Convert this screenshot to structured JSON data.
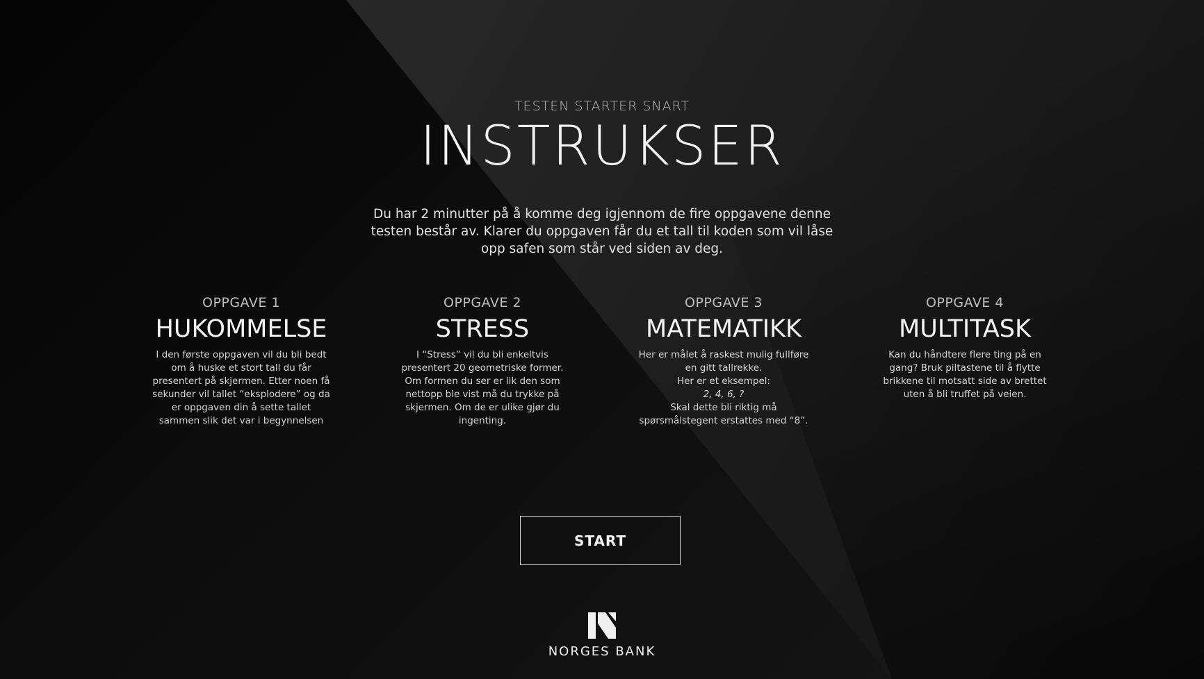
{
  "header": {
    "kicker": "TESTEN STARTER SNART",
    "title": "INSTRUKSER"
  },
  "intro": {
    "text": "Du har 2 minutter på å komme deg igjennom de fire oppgavene denne testen består av. Klarer du oppgaven får du et tall til koden som vil låse opp safen som står ved siden av deg."
  },
  "tasks": [
    {
      "label": "OPPGAVE 1",
      "title": "HUKOMMELSE",
      "lines": [
        "I den første oppgaven vil du bli bedt",
        "om å huske et stort tall du får",
        "presentert på skjermen. Etter noen få",
        "sekunder vil tallet “eksplodere” og da",
        "er oppgaven din å sette tallet",
        "sammen slik det var i begynnelsen"
      ]
    },
    {
      "label": "OPPGAVE 2",
      "title": "STRESS",
      "lines": [
        "I “Stress” vil du bli enkeltvis",
        "presentert 20 geometriske former.",
        "Om formen du ser er lik den som",
        "nettopp ble vist må du trykke på",
        "skjermen. Om de er ulike gjør du",
        "ingenting."
      ]
    },
    {
      "label": "OPPGAVE 3",
      "title": "MATEMATIKK",
      "lines": [
        "Her er målet å raskest mulig fullføre",
        "en gitt tallrekke.",
        "Her er et eksempel:",
        "2, 4, 6, ?",
        "Skal dette bli riktig må",
        "spørsmålstegent erstattes med “8”."
      ]
    },
    {
      "label": "OPPGAVE 4",
      "title": "MULTITASK",
      "lines": [
        "Kan du håndtere flere ting på en",
        "gang? Bruk piltastene til å flytte",
        "brikkene til motsatt side av brettet",
        "uten å bli truffet på veien."
      ]
    }
  ],
  "actions": {
    "start_label": "START"
  },
  "brand": {
    "name": "NORGES BANK",
    "logo_icon": "norges-bank-n-logo-icon"
  },
  "colors": {
    "background_dark": "#0a0a0a",
    "background_mid": "#262626",
    "text_primary": "#f2f2f2",
    "text_secondary": "#bdbdbd"
  }
}
